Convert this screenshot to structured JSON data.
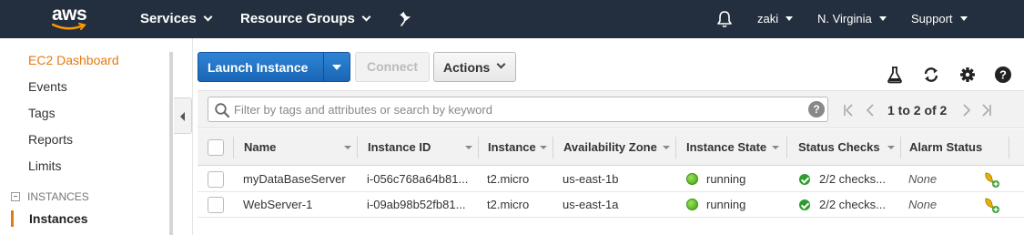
{
  "topnav": {
    "logo": "aws",
    "services": "Services",
    "resource_groups": "Resource Groups",
    "user": "zaki",
    "region": "N. Virginia",
    "support": "Support",
    "icons": [
      "pin-icon",
      "bell-icon"
    ]
  },
  "sidebar": {
    "items": [
      {
        "label": "EC2 Dashboard",
        "active": true
      },
      {
        "label": "Events"
      },
      {
        "label": "Tags"
      },
      {
        "label": "Reports"
      },
      {
        "label": "Limits"
      }
    ],
    "section": "INSTANCES",
    "selected_item": "Instances"
  },
  "toolbar": {
    "launch_label": "Launch Instance",
    "connect_label": "Connect",
    "actions_label": "Actions",
    "icons": [
      "flask-icon",
      "refresh-icon",
      "gear-icon",
      "help-icon"
    ]
  },
  "filter": {
    "placeholder": "Filter by tags and attributes or search by keyword",
    "help": "?",
    "pagination": "1 to 2 of 2"
  },
  "table": {
    "columns": [
      "Name",
      "Instance ID",
      "Instance",
      "Availability Zone",
      "Instance State",
      "Status Checks",
      "Alarm Status"
    ],
    "rows": [
      {
        "name": "myDataBaseServer",
        "instance_id": "i-056c768a64b81...",
        "type": "t2.micro",
        "az": "us-east-1b",
        "state": "running",
        "status_checks": "2/2 checks...",
        "alarm": "None"
      },
      {
        "name": "WebServer-1",
        "instance_id": "i-09ab98b52fb81...",
        "type": "t2.micro",
        "az": "us-east-1a",
        "state": "running",
        "status_checks": "2/2 checks...",
        "alarm": "None"
      }
    ]
  },
  "colors": {
    "nav_bg": "#232f3e",
    "accent_orange": "#e47911",
    "launch_blue": "#1a66b5",
    "running_green": "#3ea10f"
  }
}
